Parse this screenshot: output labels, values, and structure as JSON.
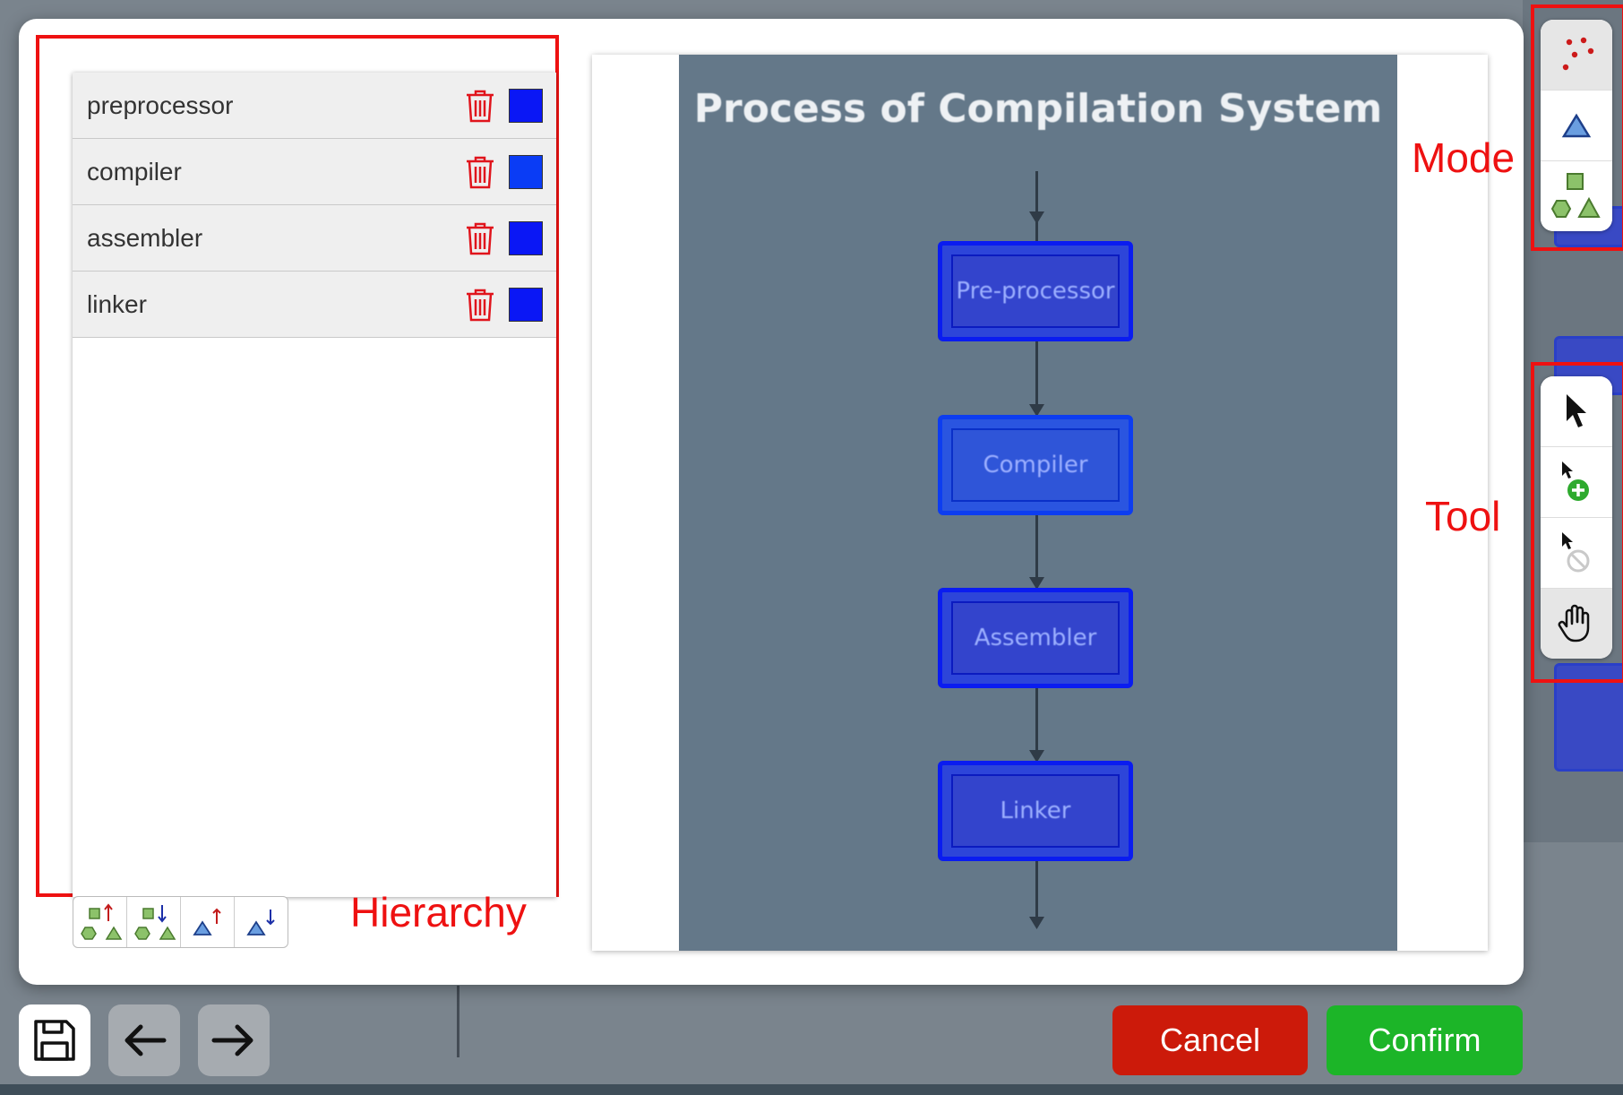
{
  "layers": [
    {
      "name": "preprocessor",
      "color": "#0a17f5"
    },
    {
      "name": "compiler",
      "color": "#0a3cf5"
    },
    {
      "name": "assembler",
      "color": "#0a17f5"
    },
    {
      "name": "linker",
      "color": "#0a17f5"
    }
  ],
  "diagram": {
    "title": "Process of Compilation System",
    "steps": [
      "Pre-processor",
      "Compiler",
      "Assembler",
      "Linker"
    ]
  },
  "annotations": {
    "mode": "Mode",
    "tool": "Tool",
    "hierarchy": "Hierarchy"
  },
  "mode_buttons": [
    "points-mode-icon",
    "polygon-mode-icon",
    "shapes-mode-icon"
  ],
  "tool_buttons": [
    "select-arrow-icon",
    "add-point-icon",
    "remove-point-icon",
    "pan-hand-icon"
  ],
  "hierarchy_buttons": [
    "group-move-up-icon",
    "group-move-down-icon",
    "shape-move-up-icon",
    "shape-move-down-icon"
  ],
  "actions": {
    "cancel": "Cancel",
    "confirm": "Confirm"
  },
  "colors": {
    "cancel": "#cc1a0a",
    "confirm": "#1cb528",
    "annotation": "#ee1111"
  }
}
